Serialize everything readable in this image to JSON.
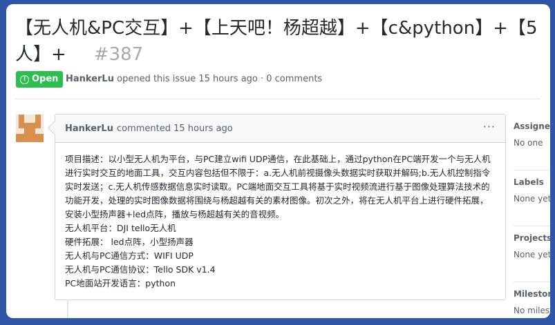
{
  "issue": {
    "title": "【无人机&PC交互】+【上天吧！杨超越】+【c&python】+【5人】+",
    "number": "#387",
    "state": "Open",
    "author": "HankerLu",
    "meta_text": "opened this issue 15 hours ago · 0 comments"
  },
  "comment": {
    "author": "HankerLu",
    "time_text": "commented 15 hours ago",
    "menu": "···",
    "body": [
      "项目描述：以小型无人机为平台，与PC建立wifi UDP通信，在此基础上，通过python在PC端开发一个与无人机进行实时交互的地面工具，交互内容包括但不限于：a.无人机前视摄像头数据实时获取并解码;b.无人机控制指令实时发送；c.无人机传感数据信息实时读取。PC端地面交互工具将基于实时视频流进行基于图像处理算法技术的功能开发，处理的实时图像数据将围绕与杨超越有关的素材图像。初次之外，将在无人机平台上进行硬件拓展，安装小型扬声器+led点阵，播放与杨超越有关的音视频。",
      "无人机平台：DJI tello无人机",
      "硬件拓展： led点阵，小型扬声器",
      "无人机与PC通信方式：WIFI UDP",
      "无人机与PC通信协议：Tello SDK v1.4",
      "PC地面站开发语言：python"
    ]
  },
  "sidebar": {
    "sections": [
      {
        "label": "Assignees",
        "value": "No one"
      },
      {
        "label": "Labels",
        "value": "None yet"
      },
      {
        "label": "Projects",
        "value": "None yet"
      },
      {
        "label": "Milestone",
        "value": "No milestone"
      }
    ]
  },
  "colors": {
    "open_green": "#2cbe4e",
    "frame_blue": "#2f55a6",
    "avatar_orange": "#d9904f"
  }
}
